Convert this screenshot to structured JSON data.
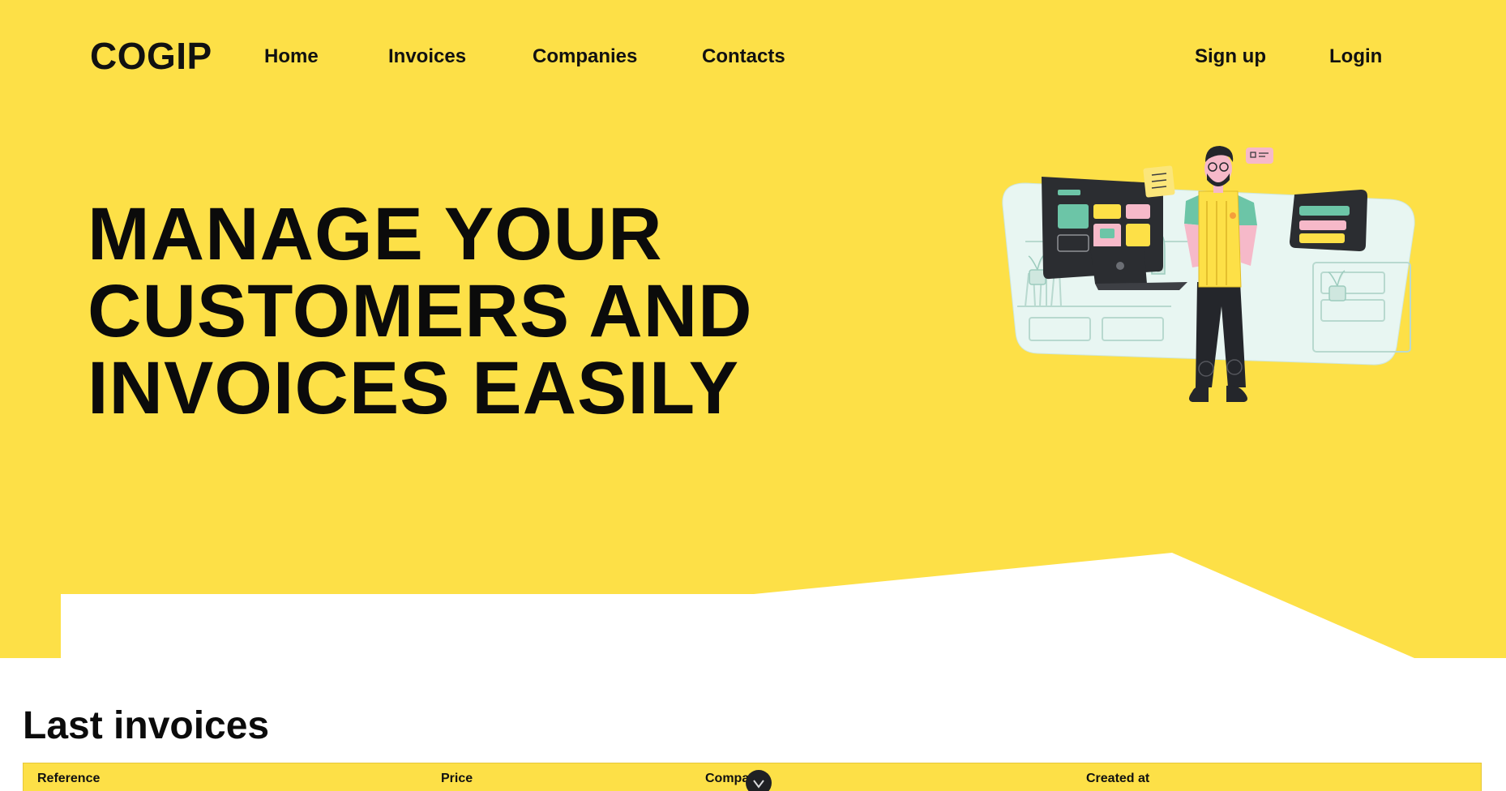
{
  "header": {
    "logo": "COGIP",
    "nav": [
      {
        "label": "Home"
      },
      {
        "label": "Invoices"
      },
      {
        "label": "Companies"
      },
      {
        "label": "Contacts"
      }
    ],
    "auth": {
      "signup_label": "Sign up",
      "login_label": "Login"
    }
  },
  "hero": {
    "headline_lines": [
      "MANAGE YOUR",
      "CUSTOMERS AND",
      "INVOICES EASILY"
    ],
    "illustration_icon": "person-with-dashboard-illustration"
  },
  "last_invoices": {
    "title": "Last invoices",
    "columns": [
      "Reference",
      "Price",
      "Company",
      "Created at"
    ]
  },
  "scroll_button": {
    "icon": "chevron-down-icon"
  },
  "colors": {
    "brand_yellow": "#fde047",
    "text_dark": "#111111",
    "background": "#ffffff"
  }
}
